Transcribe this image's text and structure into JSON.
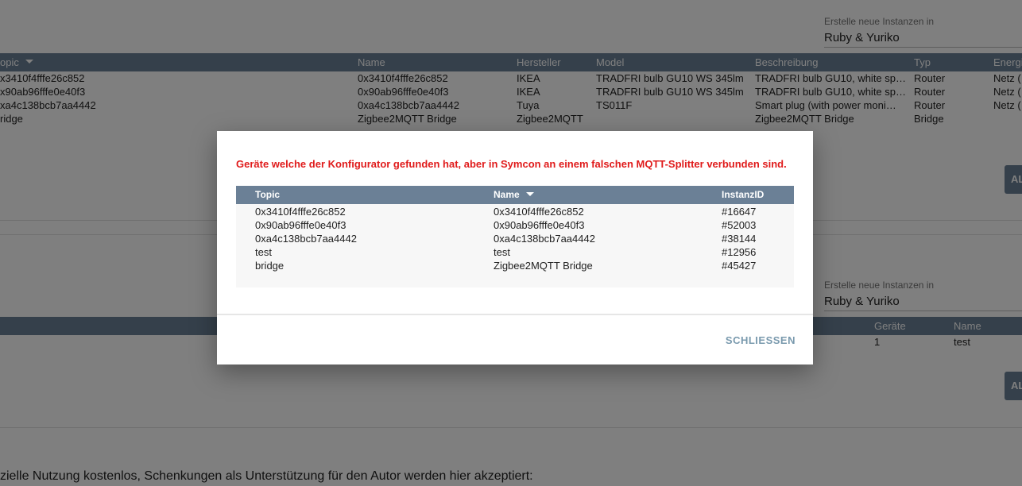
{
  "panel1": {
    "create_label": "Erstelle neue Instanzen in",
    "create_value": "Ruby & Yuriko",
    "columns": [
      "opic",
      "Name",
      "Hersteller",
      "Model",
      "Beschreibung",
      "Typ",
      "Energi"
    ],
    "rows": [
      [
        "x3410f4fffe26c852",
        "0x3410f4fffe26c852",
        "IKEA",
        "TRADFRI bulb GU10 WS 345lm",
        "TRADFRI bulb GU10, white sp…",
        "Router",
        "Netz ("
      ],
      [
        "x90ab96fffe0e40f3",
        "0x90ab96fffe0e40f3",
        "IKEA",
        "TRADFRI bulb GU10 WS 345lm",
        "TRADFRI bulb GU10, white sp…",
        "Router",
        "Netz ("
      ],
      [
        "xa4c138bcb7aa4442",
        "0xa4c138bcb7aa4442",
        "Tuya",
        "TS011F",
        "Smart plug (with power moni…",
        "Router",
        "Netz ("
      ],
      [
        "ridge",
        "Zigbee2MQTT Bridge",
        "Zigbee2MQTT",
        "",
        "Zigbee2MQTT Bridge",
        "Bridge",
        ""
      ]
    ],
    "button_label": "AL"
  },
  "panel2": {
    "create_label": "Erstelle neue Instanzen in",
    "create_value": "Ruby & Yuriko",
    "columns": [
      "Geräte",
      "Name"
    ],
    "rows": [
      [
        "1",
        "test"
      ]
    ],
    "button_label": "AL"
  },
  "footer_text": "zielle Nutzung kostenlos, Schenkungen als Unterstützung für den Autor werden hier akzeptiert:",
  "dialog": {
    "message": "Geräte welche der Konfigurator gefunden hat, aber in Symcon an einem falschen MQTT-Splitter verbunden sind.",
    "columns": [
      "Topic",
      "Name",
      "InstanzID"
    ],
    "sort_icon": "sort-descending-icon",
    "rows": [
      [
        "0x3410f4fffe26c852",
        "0x3410f4fffe26c852",
        "#16647"
      ],
      [
        "0x90ab96fffe0e40f3",
        "0x90ab96fffe0e40f3",
        "#52003"
      ],
      [
        "0xa4c138bcb7aa4442",
        "0xa4c138bcb7aa4442",
        "#38144"
      ],
      [
        "test",
        "test",
        "#12956"
      ],
      [
        "bridge",
        "Zigbee2MQTT Bridge",
        "#45427"
      ]
    ],
    "close_label": "SCHLIESSEN"
  },
  "colors": {
    "table_header": "#6b8096",
    "error_text": "#e01b1b",
    "close_text": "#7a9aae"
  }
}
